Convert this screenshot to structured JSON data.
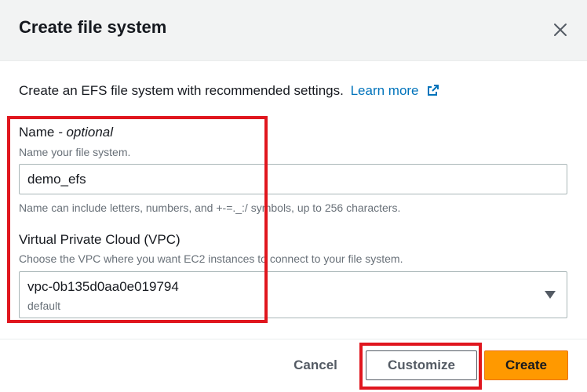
{
  "dialog": {
    "title": "Create file system",
    "intro": "Create an EFS file system with recommended settings.",
    "learn_more": "Learn more"
  },
  "name_field": {
    "label": "Name",
    "label_optional": "- optional",
    "description": "Name your file system.",
    "value": "demo_efs",
    "constraint": "Name can include letters, numbers, and +-=._:/ symbols, up to 256 characters."
  },
  "vpc_field": {
    "label": "Virtual Private Cloud (VPC)",
    "description": "Choose the VPC where you want EC2 instances to connect to your file system.",
    "selected_value": "vpc-0b135d0aa0e019794",
    "selected_sub": "default"
  },
  "footer": {
    "cancel_label": "Cancel",
    "customize_label": "Customize",
    "create_label": "Create"
  },
  "colors": {
    "primary_button": "#ff9900",
    "link": "#0073bb",
    "annotation_highlight": "#e0161e"
  },
  "icons": {
    "close": "close-icon",
    "external_link": "external-link-icon",
    "dropdown": "caret-down-icon"
  }
}
